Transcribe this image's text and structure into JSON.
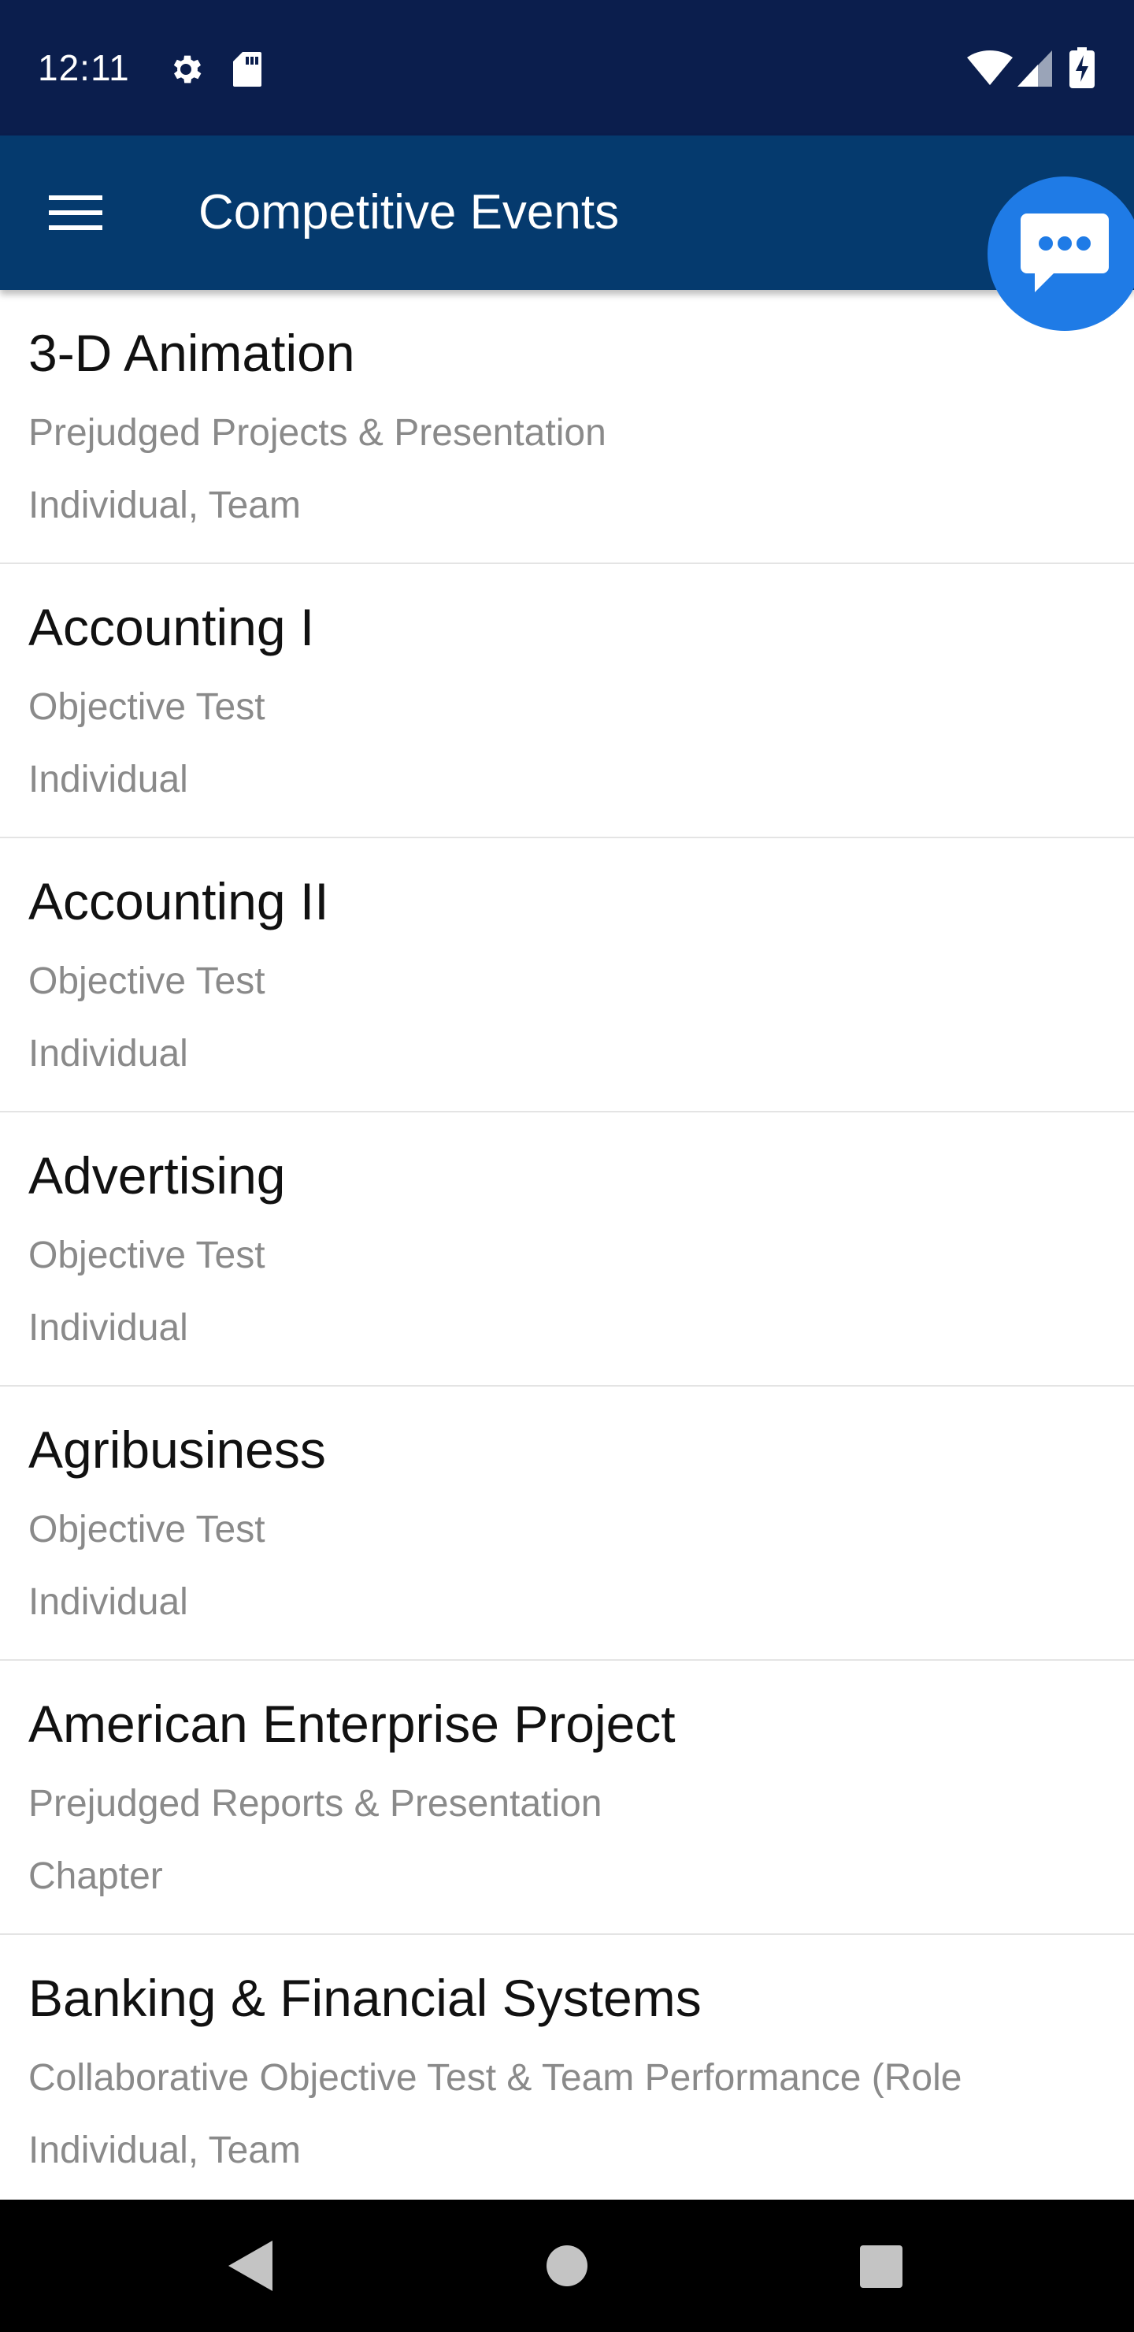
{
  "status_bar": {
    "time": "12:11",
    "icons": [
      "gear-icon",
      "sd-card-icon",
      "wifi-icon",
      "cell-signal-icon",
      "battery-charging-icon"
    ]
  },
  "app_bar": {
    "title": "Competitive Events",
    "menu_icon": "hamburger-menu-icon"
  },
  "chat_fab": {
    "icon": "chat-bubble-icon",
    "color": "#1f7be6"
  },
  "colors": {
    "status_bar_bg": "#0b1e4d",
    "app_bar_bg": "#053a6e",
    "secondary_text": "#8a8a8a"
  },
  "events": [
    {
      "title": "3-D Animation",
      "type": "Prejudged Projects & Presentation",
      "participation": "Individual, Team"
    },
    {
      "title": "Accounting I",
      "type": "Objective Test",
      "participation": "Individual"
    },
    {
      "title": "Accounting II",
      "type": "Objective Test",
      "participation": "Individual"
    },
    {
      "title": "Advertising",
      "type": "Objective Test",
      "participation": "Individual"
    },
    {
      "title": "Agribusiness",
      "type": "Objective Test",
      "participation": "Individual"
    },
    {
      "title": "American Enterprise Project",
      "type": "Prejudged Reports & Presentation",
      "participation": "Chapter"
    },
    {
      "title": "Banking & Financial Systems",
      "type": "Collaborative Objective Test & Team Performance (Role",
      "participation": "Individual, Team"
    }
  ],
  "nav_bar": {
    "back_icon": "back-triangle-icon",
    "home_icon": "home-circle-icon",
    "recents_icon": "recents-square-icon"
  }
}
